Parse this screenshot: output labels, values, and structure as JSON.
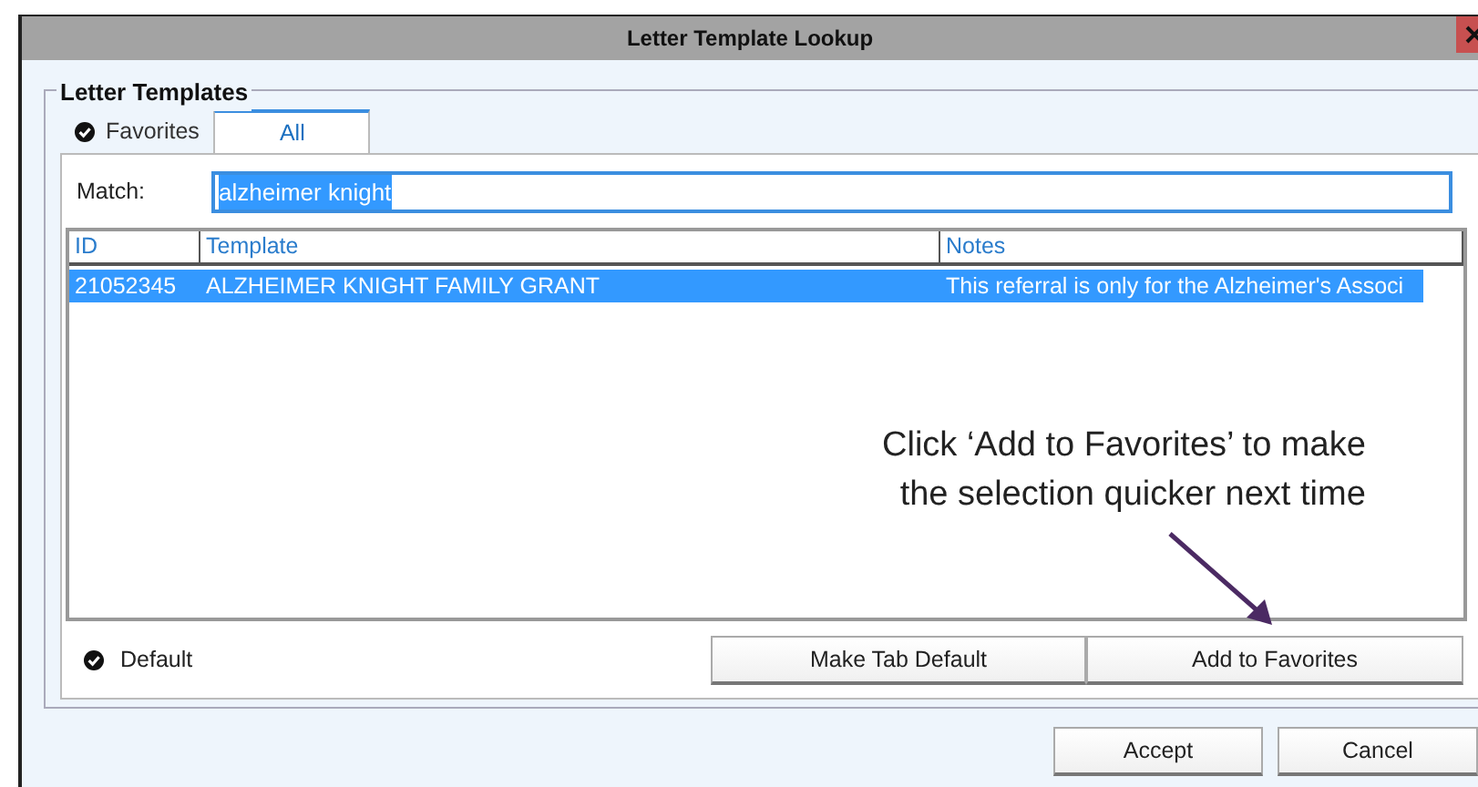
{
  "window": {
    "title": "Letter Template Lookup"
  },
  "group": {
    "title": "Letter Templates"
  },
  "tabs": [
    {
      "label": "Favorites",
      "selected": false,
      "default": true
    },
    {
      "label": "All",
      "selected": true,
      "default": false
    }
  ],
  "match": {
    "label": "Match:",
    "value": "alzheimer knight"
  },
  "table": {
    "columns": [
      "ID",
      "Template",
      "Notes"
    ],
    "rows": [
      {
        "cells": [
          "21052345",
          "ALZHEIMER KNIGHT FAMILY GRANT",
          "This referral is only for the Alzheimer's Associ"
        ],
        "selected": true
      }
    ]
  },
  "annotation": {
    "lines": [
      "Click ‘Add to Favorites’ to make",
      "the selection quicker next time"
    ]
  },
  "default_option": {
    "label": "Default",
    "checked": true
  },
  "tab_buttons": [
    "Make Tab Default",
    "Add to Favorites"
  ],
  "buttons": [
    "Accept",
    "Cancel"
  ]
}
